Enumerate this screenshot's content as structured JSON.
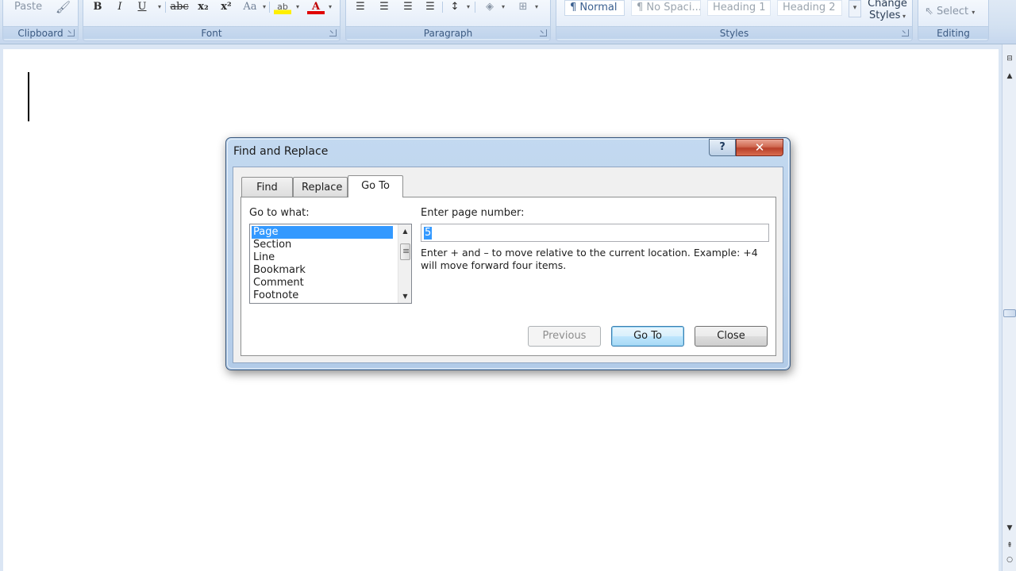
{
  "ribbon": {
    "clipboard": {
      "label": "Clipboard",
      "paste_label": "Paste"
    },
    "font": {
      "label": "Font",
      "bold": "B",
      "italic": "I",
      "underline": "U",
      "strike": "abc",
      "subscript": "x₂",
      "superscript": "x²",
      "change_case": "Aa",
      "font_color": "A"
    },
    "paragraph": {
      "label": "Paragraph"
    },
    "styles": {
      "label": "Styles",
      "items": [
        "¶ Normal",
        "¶ No Spaci...",
        "Heading 1",
        "Heading 2"
      ],
      "change_styles": [
        "Change",
        "Styles"
      ]
    },
    "editing": {
      "label": "Editing",
      "select": "Select"
    }
  },
  "dialog": {
    "title": "Find and Replace",
    "help": "?",
    "close_glyph": "✕",
    "tabs": [
      "Find",
      "Replace",
      "Go To"
    ],
    "active_tab": "Go To",
    "goto_what_label": "Go to what:",
    "goto_items": [
      "Page",
      "Section",
      "Line",
      "Bookmark",
      "Comment",
      "Footnote"
    ],
    "selected_item": "Page",
    "page_number_label": "Enter page number:",
    "page_number_value": "5",
    "hint": "Enter + and – to move relative to the current location. Example: +4 will move forward four items.",
    "buttons": {
      "previous": "Previous",
      "goto": "Go To",
      "close": "Close"
    }
  },
  "colors": {
    "selection": "#3399ff",
    "ribbon_bg": "#dfe9f5",
    "close_red": "#c94f36"
  }
}
